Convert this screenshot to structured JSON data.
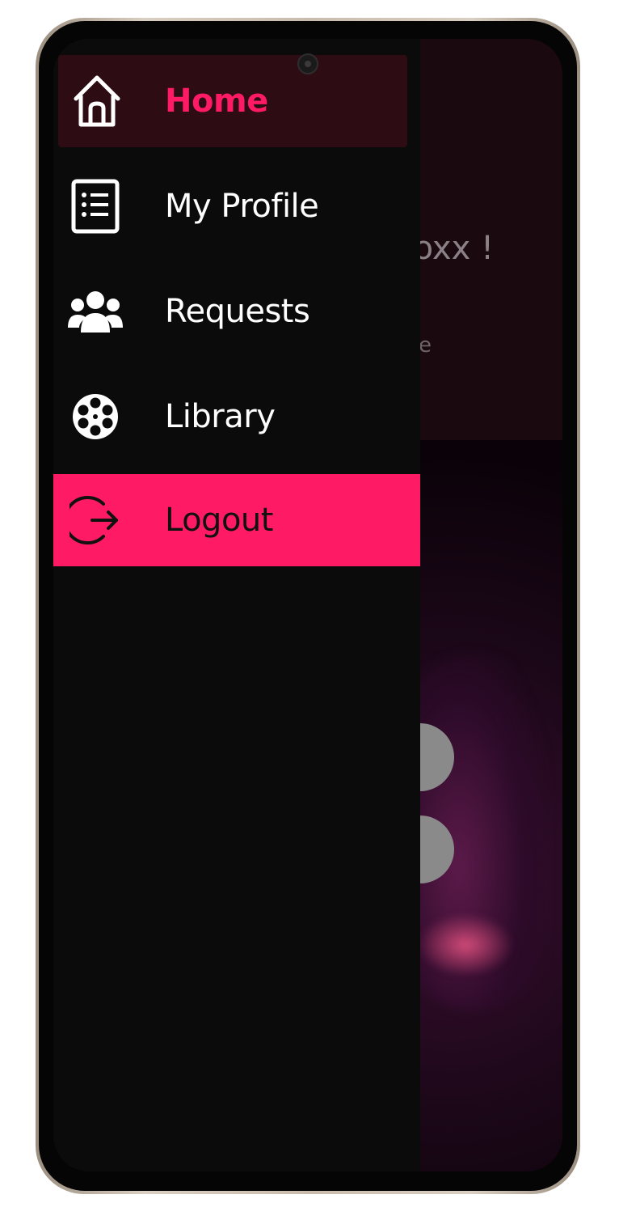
{
  "drawer": {
    "items": [
      {
        "label": "Home",
        "icon": "home-icon",
        "active": true
      },
      {
        "label": "My Profile",
        "icon": "profile-list-icon"
      },
      {
        "label": "Requests",
        "icon": "users-group-icon"
      },
      {
        "label": "Library",
        "icon": "film-reel-icon"
      },
      {
        "label": "Logout",
        "icon": "logout-icon",
        "highlighted": true
      }
    ]
  },
  "background_screen": {
    "greeting_fragment": "oxoxx !",
    "subtext_fragment": "e"
  },
  "colors": {
    "accent": "#ff1a66",
    "active_item_bg": "#2d0c14",
    "drawer_bg": "#0b0b0b",
    "text_default": "#ffffff"
  }
}
